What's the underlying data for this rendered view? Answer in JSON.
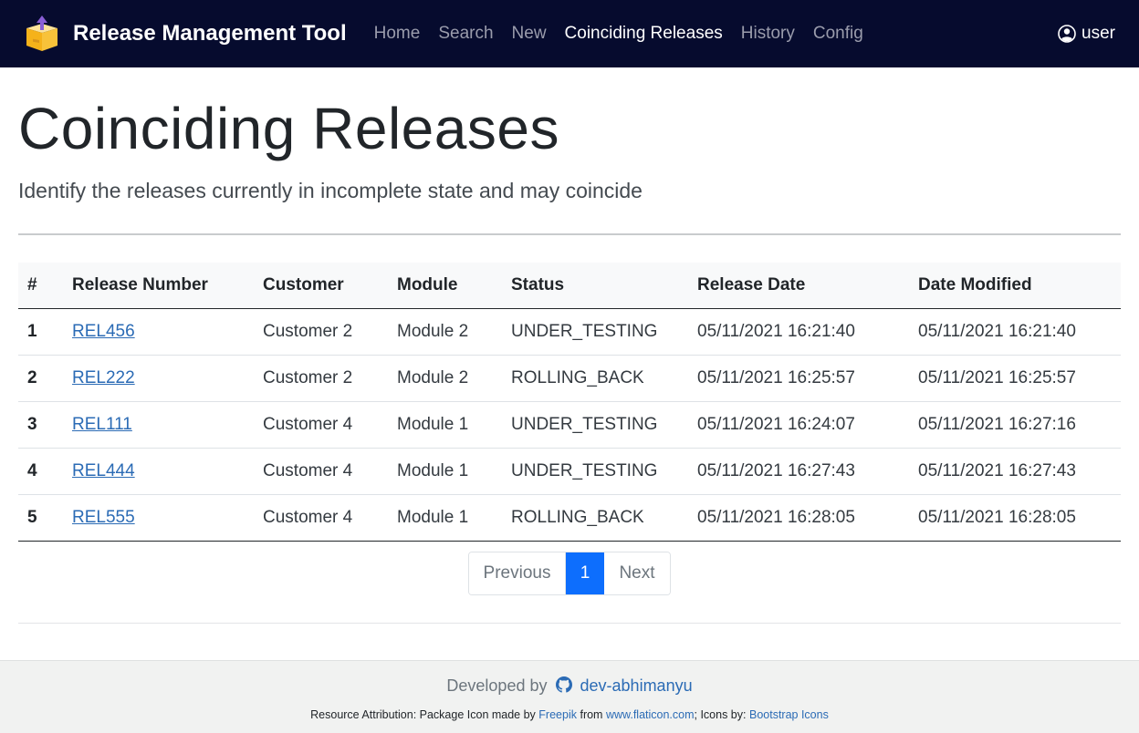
{
  "navbar": {
    "brand": "Release Management Tool",
    "links": [
      {
        "label": "Home",
        "active": false
      },
      {
        "label": "Search",
        "active": false
      },
      {
        "label": "New",
        "active": false
      },
      {
        "label": "Coinciding Releases",
        "active": true
      },
      {
        "label": "History",
        "active": false
      },
      {
        "label": "Config",
        "active": false
      }
    ],
    "user": "user"
  },
  "header": {
    "title": "Coinciding Releases",
    "lead": "Identify the releases currently in incomplete state and may coincide"
  },
  "table": {
    "columns": [
      "#",
      "Release Number",
      "Customer",
      "Module",
      "Status",
      "Release Date",
      "Date Modified"
    ],
    "rows": [
      {
        "index": "1",
        "release": "REL456",
        "customer": "Customer 2",
        "module": "Module 2",
        "status": "UNDER_TESTING",
        "release_date": "05/11/2021 16:21:40",
        "modified": "05/11/2021 16:21:40"
      },
      {
        "index": "2",
        "release": "REL222",
        "customer": "Customer 2",
        "module": "Module 2",
        "status": "ROLLING_BACK",
        "release_date": "05/11/2021 16:25:57",
        "modified": "05/11/2021 16:25:57"
      },
      {
        "index": "3",
        "release": "REL111",
        "customer": "Customer 4",
        "module": "Module 1",
        "status": "UNDER_TESTING",
        "release_date": "05/11/2021 16:24:07",
        "modified": "05/11/2021 16:27:16"
      },
      {
        "index": "4",
        "release": "REL444",
        "customer": "Customer 4",
        "module": "Module 1",
        "status": "UNDER_TESTING",
        "release_date": "05/11/2021 16:27:43",
        "modified": "05/11/2021 16:27:43"
      },
      {
        "index": "5",
        "release": "REL555",
        "customer": "Customer 4",
        "module": "Module 1",
        "status": "ROLLING_BACK",
        "release_date": "05/11/2021 16:28:05",
        "modified": "05/11/2021 16:28:05"
      }
    ]
  },
  "pagination": {
    "previous": "Previous",
    "current": "1",
    "next": "Next"
  },
  "footer": {
    "developed_by": "Developed by",
    "developer": "dev-abhimanyu",
    "attribution_prefix": "Resource Attribution: Package Icon made by",
    "freepik": "Freepik",
    "from": "from",
    "flaticon": "www.flaticon.com",
    "icons_by": "; Icons by:",
    "bootstrap_icons": "Bootstrap Icons"
  },
  "colors": {
    "navbar_bg": "#060b2e",
    "link": "#2b6bb5",
    "active_page": "#0d6efd",
    "footer_bg": "#f1f2f1"
  },
  "icons": {
    "brand": "package-icon",
    "user": "person-circle-icon",
    "footer": "github-icon"
  }
}
